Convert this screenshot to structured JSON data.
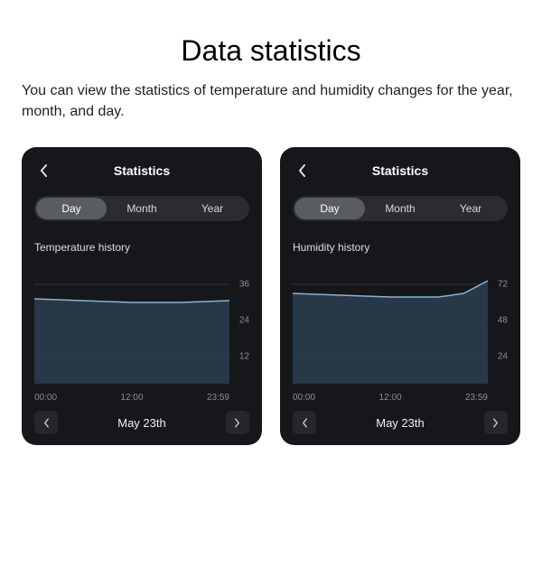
{
  "page": {
    "title": "Data statistics",
    "subtitle": "You can view the statistics of temperature and humidity changes for the year, month, and day."
  },
  "tabs": {
    "day": "Day",
    "month": "Month",
    "year": "Year"
  },
  "screen_title": "Statistics",
  "x_ticks": {
    "t0": "00:00",
    "t1": "12:00",
    "t2": "23:59"
  },
  "date_label": "May 23th",
  "left": {
    "chart_label": "Temperature history",
    "y_ticks": {
      "a": "36",
      "b": "24",
      "c": "12"
    }
  },
  "right": {
    "chart_label": "Humidity history",
    "y_ticks": {
      "a": "72",
      "b": "48",
      "c": "24"
    }
  },
  "chart_data": [
    {
      "type": "line",
      "title": "Temperature history",
      "xlabel": "",
      "ylabel": "",
      "ylim": [
        0,
        36
      ],
      "x_tick_labels": [
        "00:00",
        "12:00",
        "23:59"
      ],
      "y_tick_labels": [
        12,
        24,
        36
      ],
      "series": [
        {
          "name": "temperature",
          "x": [
            0,
            6,
            12,
            18,
            23.98
          ],
          "values": [
            28,
            27.5,
            27,
            27,
            27.5
          ]
        }
      ]
    },
    {
      "type": "line",
      "title": "Humidity history",
      "xlabel": "",
      "ylabel": "",
      "ylim": [
        0,
        72
      ],
      "x_tick_labels": [
        "00:00",
        "12:00",
        "23:59"
      ],
      "y_tick_labels": [
        24,
        48,
        72
      ],
      "series": [
        {
          "name": "humidity",
          "x": [
            0,
            6,
            12,
            18,
            21,
            23.98
          ],
          "values": [
            62,
            61,
            60,
            60,
            62,
            70
          ]
        }
      ]
    }
  ]
}
